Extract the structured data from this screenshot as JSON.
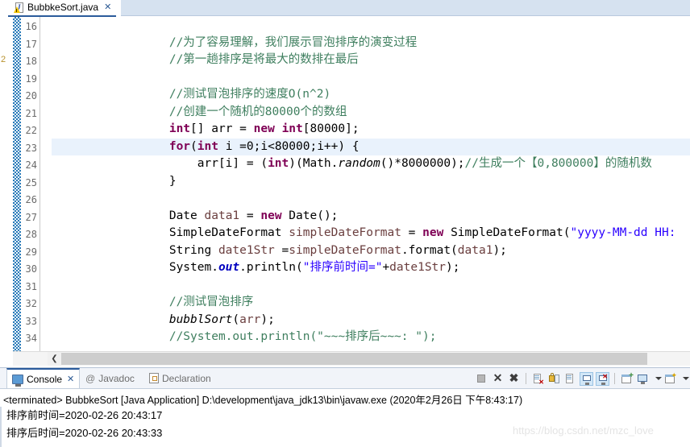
{
  "editor": {
    "tab": {
      "label": "BubbkeSort.java",
      "close_glyph": "✕",
      "icon": "java-file-warning-icon"
    },
    "overview_ruler_mark": "2",
    "line_numbers": [
      16,
      17,
      18,
      19,
      20,
      21,
      22,
      23,
      24,
      25,
      26,
      27,
      28,
      29,
      30,
      31,
      32,
      33,
      34
    ],
    "highlighted_line": 23,
    "lines": [
      {
        "no": 16,
        "segments": []
      },
      {
        "no": 17,
        "segments": [
          {
            "t": "        ",
            "c": "plain"
          },
          {
            "t": "//为了容易理解，我们展示冒泡排序的演变过程",
            "c": "cmt"
          }
        ]
      },
      {
        "no": 18,
        "segments": [
          {
            "t": "        ",
            "c": "plain"
          },
          {
            "t": "//第一趟排序是将最大的数排在最后",
            "c": "cmt"
          }
        ]
      },
      {
        "no": 19,
        "segments": []
      },
      {
        "no": 20,
        "segments": [
          {
            "t": "        ",
            "c": "plain"
          },
          {
            "t": "//测试冒泡排序的速度O(n^2)",
            "c": "cmt"
          }
        ]
      },
      {
        "no": 21,
        "segments": [
          {
            "t": "        ",
            "c": "plain"
          },
          {
            "t": "//创建一个随机的80000个的数组",
            "c": "cmt"
          }
        ]
      },
      {
        "no": 22,
        "segments": [
          {
            "t": "        ",
            "c": "plain"
          },
          {
            "t": "int",
            "c": "kw"
          },
          {
            "t": "[] arr = ",
            "c": "plain"
          },
          {
            "t": "new",
            "c": "kw"
          },
          {
            "t": " ",
            "c": "plain"
          },
          {
            "t": "int",
            "c": "kw"
          },
          {
            "t": "[80000];",
            "c": "plain"
          }
        ]
      },
      {
        "no": 23,
        "segments": [
          {
            "t": "        ",
            "c": "plain"
          },
          {
            "t": "for",
            "c": "kw"
          },
          {
            "t": "(",
            "c": "plain"
          },
          {
            "t": "int",
            "c": "kw"
          },
          {
            "t": " i =0;i<80000;i++) {",
            "c": "plain"
          }
        ]
      },
      {
        "no": 24,
        "segments": [
          {
            "t": "            arr[i] = (",
            "c": "plain"
          },
          {
            "t": "int",
            "c": "kw"
          },
          {
            "t": ")(Math.",
            "c": "plain"
          },
          {
            "t": "random",
            "c": "mth"
          },
          {
            "t": "()*8000000);",
            "c": "plain"
          },
          {
            "t": "//生成一个【0,800000】的随机数",
            "c": "cmt"
          }
        ]
      },
      {
        "no": 25,
        "segments": [
          {
            "t": "        }",
            "c": "plain"
          }
        ]
      },
      {
        "no": 26,
        "segments": []
      },
      {
        "no": 27,
        "segments": [
          {
            "t": "        Date ",
            "c": "plain"
          },
          {
            "t": "data1",
            "c": "loc"
          },
          {
            "t": " = ",
            "c": "plain"
          },
          {
            "t": "new",
            "c": "kw"
          },
          {
            "t": " Date();",
            "c": "plain"
          }
        ]
      },
      {
        "no": 28,
        "segments": [
          {
            "t": "        SimpleDateFormat ",
            "c": "plain"
          },
          {
            "t": "simpleDateFormat",
            "c": "loc"
          },
          {
            "t": " = ",
            "c": "plain"
          },
          {
            "t": "new",
            "c": "kw"
          },
          {
            "t": " SimpleDateFormat(",
            "c": "plain"
          },
          {
            "t": "\"yyyy-MM-dd HH:",
            "c": "str"
          }
        ]
      },
      {
        "no": 29,
        "segments": [
          {
            "t": "        String ",
            "c": "plain"
          },
          {
            "t": "date1Str",
            "c": "loc"
          },
          {
            "t": " =",
            "c": "plain"
          },
          {
            "t": "simpleDateFormat",
            "c": "loc"
          },
          {
            "t": ".format(",
            "c": "plain"
          },
          {
            "t": "data1",
            "c": "loc"
          },
          {
            "t": ");",
            "c": "plain"
          }
        ]
      },
      {
        "no": 30,
        "segments": [
          {
            "t": "        System.",
            "c": "plain"
          },
          {
            "t": "out",
            "c": "fld"
          },
          {
            "t": ".println(",
            "c": "plain"
          },
          {
            "t": "\"排序前时间=\"",
            "c": "str"
          },
          {
            "t": "+",
            "c": "plain"
          },
          {
            "t": "date1Str",
            "c": "loc"
          },
          {
            "t": ");",
            "c": "plain"
          }
        ]
      },
      {
        "no": 31,
        "segments": []
      },
      {
        "no": 32,
        "segments": [
          {
            "t": "        ",
            "c": "plain"
          },
          {
            "t": "//测试冒泡排序",
            "c": "cmt"
          }
        ]
      },
      {
        "no": 33,
        "segments": [
          {
            "t": "        ",
            "c": "plain"
          },
          {
            "t": "bubblSort",
            "c": "mth"
          },
          {
            "t": "(",
            "c": "plain"
          },
          {
            "t": "arr",
            "c": "loc"
          },
          {
            "t": ");",
            "c": "plain"
          }
        ]
      },
      {
        "no": 34,
        "segments": [
          {
            "t": "        ",
            "c": "plain"
          },
          {
            "t": "//System.out.println(\"~~~排序后~~~: \");",
            "c": "cmt"
          }
        ]
      }
    ],
    "hscroll": {
      "left_arrow": "❮"
    }
  },
  "console": {
    "tabs": [
      {
        "label": "Console",
        "icon": "console-icon",
        "selected": true,
        "close_glyph": "✕"
      },
      {
        "label": "Javadoc",
        "icon": "at-icon",
        "selected": false
      },
      {
        "label": "Declaration",
        "icon": "declaration-icon",
        "selected": false
      }
    ],
    "toolbar": [
      {
        "name": "terminate-button",
        "icon": "stop-square-icon"
      },
      {
        "name": "remove-launch-button",
        "icon": "x-icon"
      },
      {
        "name": "remove-all-terminated-button",
        "icon": "xx-icon"
      },
      {
        "name": "toolbar-separator-1",
        "icon": "separator"
      },
      {
        "name": "clear-console-button",
        "icon": "clear-console-icon"
      },
      {
        "name": "scroll-lock-button",
        "icon": "lock-icon"
      },
      {
        "name": "word-wrap-button",
        "icon": "wrap-icon"
      },
      {
        "name": "show-console-on-output-button",
        "icon": "console-out-icon",
        "active": true
      },
      {
        "name": "show-console-on-error-button",
        "icon": "console-err-icon",
        "active": true
      },
      {
        "name": "toolbar-separator-2",
        "icon": "separator"
      },
      {
        "name": "pin-console-button",
        "icon": "pin-console-icon"
      },
      {
        "name": "display-selected-console-button",
        "icon": "display-console-icon"
      },
      {
        "name": "display-selected-console-dropdown",
        "icon": "chevron-down-icon"
      },
      {
        "name": "open-console-button",
        "icon": "new-console-icon"
      },
      {
        "name": "open-console-dropdown",
        "icon": "chevron-down-icon"
      }
    ],
    "headline": "<terminated> BubbkeSort [Java Application] D:\\development\\java_jdk13\\bin\\javaw.exe (2020年2月26日 下午8:43:17)",
    "output": [
      "排序前时间=2020-02-26 20:43:17",
      "排序后时间=2020-02-26 20:43:33"
    ]
  },
  "watermark": "https://blog.csdn.net/mzc_love"
}
